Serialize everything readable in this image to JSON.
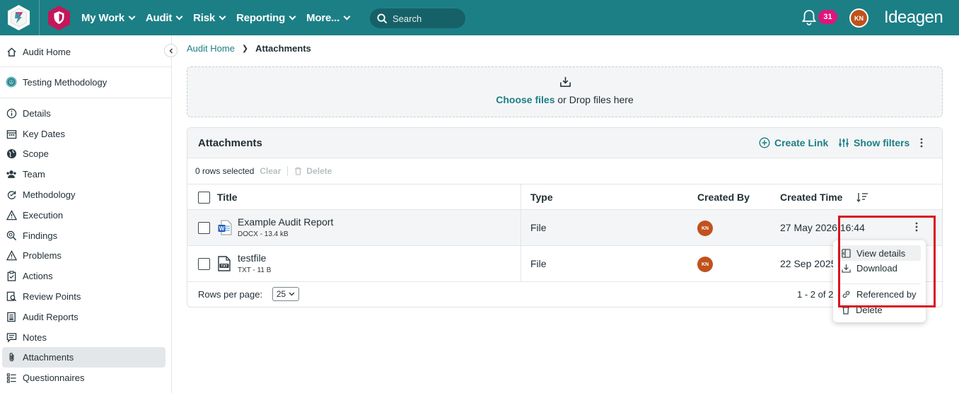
{
  "topbar": {
    "nav": [
      "My Work",
      "Audit",
      "Risk",
      "Reporting",
      "More..."
    ],
    "search_placeholder": "Search",
    "notification_count": "31",
    "user_initials": "KN",
    "brand": "Ideagen"
  },
  "sidebar": {
    "home": "Audit Home",
    "project": "Testing Methodology",
    "items": [
      "Details",
      "Key Dates",
      "Scope",
      "Team",
      "Methodology",
      "Execution",
      "Findings",
      "Problems",
      "Actions",
      "Review Points",
      "Audit Reports",
      "Notes",
      "Attachments",
      "Questionnaires"
    ],
    "active": "Attachments"
  },
  "breadcrumb": {
    "parent": "Audit Home",
    "current": "Attachments"
  },
  "upload": {
    "choose": "Choose files",
    "rest": " or Drop files here"
  },
  "panel": {
    "title": "Attachments",
    "create_link": "Create Link",
    "show_filters": "Show filters",
    "selected": "0 rows selected",
    "clear": "Clear",
    "delete": "Delete",
    "columns": {
      "title": "Title",
      "type": "Type",
      "created_by": "Created By",
      "created_time": "Created Time"
    },
    "rows": [
      {
        "title": "Example Audit Report",
        "meta": "DOCX - 13.4 kB",
        "type": "File",
        "created_by": "KN",
        "time": "27 May 2026 16:44"
      },
      {
        "title": "testfile",
        "meta": "TXT - 11 B",
        "type": "File",
        "created_by": "KN",
        "time": "22 Sep 2025"
      }
    ],
    "rows_per_page_label": "Rows per page:",
    "rows_per_page": "25",
    "range": "1 - 2 of 2"
  },
  "menu": {
    "view": "View details",
    "download": "Download",
    "referenced": "Referenced by",
    "delete": "Delete"
  },
  "colors": {
    "teal": "#1c7f86",
    "badge": "#e0157b",
    "avatar": "#c0521d",
    "highlight": "#d7141f"
  }
}
